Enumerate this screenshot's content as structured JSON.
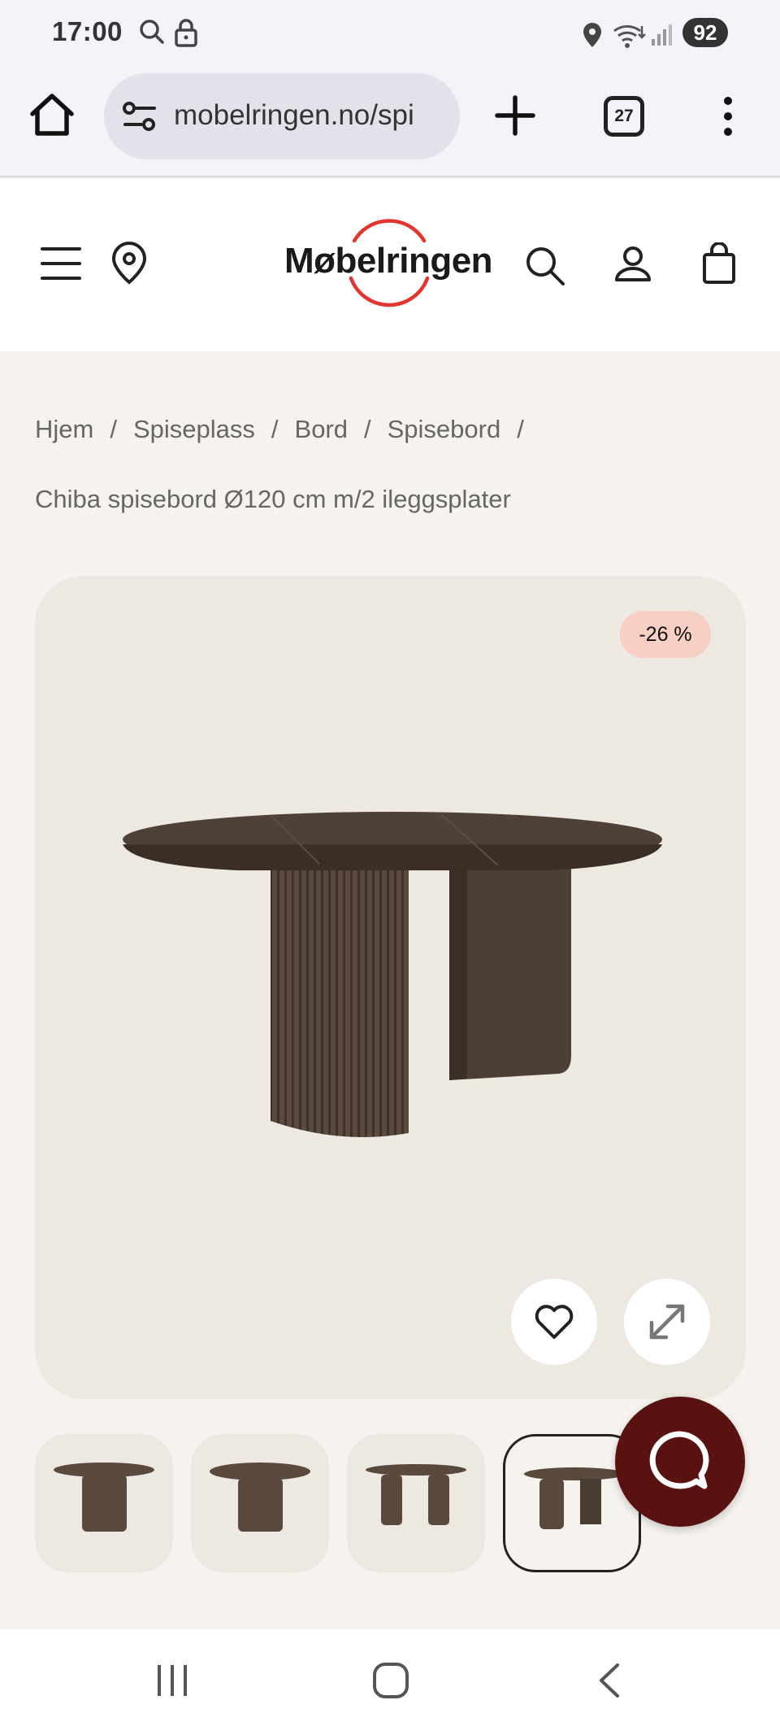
{
  "status_bar": {
    "time": "17:00",
    "battery": "92"
  },
  "browser": {
    "url": "mobelringen.no/spi",
    "tab_count": "27"
  },
  "site": {
    "logo": "Møbelringen",
    "brand_color": "#e3342f"
  },
  "breadcrumb": {
    "items": [
      "Hjem",
      "Spiseplass",
      "Bord",
      "Spisebord"
    ],
    "separator": "/"
  },
  "product": {
    "title": "Chiba spisebord Ø120 cm m/2 ileggsplater",
    "discount": "-26 %"
  },
  "thumbnails": {
    "count": 4,
    "active_index": 3
  },
  "icons": [
    "search-icon",
    "lock-icon",
    "location-icon",
    "wifi-icon",
    "signal-icon",
    "home-icon",
    "tune-icon",
    "plus-icon",
    "more-icon",
    "menu-icon",
    "map-pin-icon",
    "search-icon",
    "user-icon",
    "cart-icon",
    "heart-icon",
    "expand-icon",
    "chat-icon",
    "recents-icon",
    "home-nav-icon",
    "back-icon"
  ]
}
